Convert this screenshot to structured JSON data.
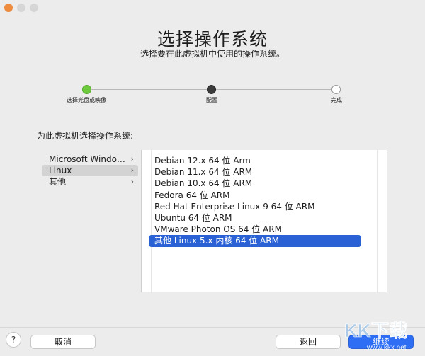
{
  "window": {
    "title": "选择操作系统",
    "subtitle": "选择要在此虚拟机中使用的操作系统。"
  },
  "steps": [
    {
      "label": "选择光盘或映像",
      "state": "done"
    },
    {
      "label": "配置",
      "state": "current"
    },
    {
      "label": "完成",
      "state": "pending"
    }
  ],
  "section_label": "为此虚拟机选择操作系统:",
  "categories": [
    {
      "label": "Microsoft Windo…",
      "selected": false
    },
    {
      "label": "Linux",
      "selected": true
    },
    {
      "label": "其他",
      "selected": false
    }
  ],
  "os_list": [
    {
      "label": "Debian 12.x 64 位 Arm",
      "selected": false
    },
    {
      "label": "Debian 11.x 64 位 ARM",
      "selected": false
    },
    {
      "label": "Debian 10.x 64 位 ARM",
      "selected": false
    },
    {
      "label": "Fedora 64 位 ARM",
      "selected": false
    },
    {
      "label": "Red Hat Enterprise Linux 9 64 位 ARM",
      "selected": false
    },
    {
      "label": "Ubuntu 64 位 ARM",
      "selected": false
    },
    {
      "label": "VMware Photon OS 64 位 ARM",
      "selected": false
    },
    {
      "label": "其他 Linux 5.x 内核 64 位 ARM",
      "selected": true
    }
  ],
  "buttons": {
    "help": "?",
    "cancel": "取消",
    "back": "返回",
    "next": "继续"
  },
  "watermark": {
    "text": "KK下载",
    "url": "www.kkx.net"
  },
  "colors": {
    "accent": "#2a62d6",
    "step_done": "#6dc93c",
    "step_current": "#3a3a3a"
  }
}
